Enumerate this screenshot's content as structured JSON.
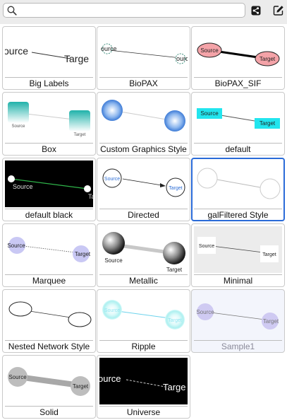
{
  "toolbar": {
    "search_value": "",
    "share_icon": "share-icon",
    "edit_icon": "edit-icon"
  },
  "styles": [
    {
      "label": "Big Labels",
      "source": "ource",
      "target": "Targe"
    },
    {
      "label": "BioPAX",
      "source": "ource",
      "target": "ource"
    },
    {
      "label": "BioPAX_SIF",
      "source": "Source",
      "target": "Target"
    },
    {
      "label": "Box",
      "source": "Source",
      "target": "Target"
    },
    {
      "label": "Custom Graphics Style",
      "source": "",
      "target": ""
    },
    {
      "label": "default",
      "source": "Source",
      "target": "Target"
    },
    {
      "label": "default black",
      "source": "Source",
      "target": "Ta"
    },
    {
      "label": "Directed",
      "source": "Source",
      "target": "Target"
    },
    {
      "label": "galFiltered Style",
      "source": "",
      "target": ""
    },
    {
      "label": "Marquee",
      "source": "Source",
      "target": "Target"
    },
    {
      "label": "Metallic",
      "source": "Source",
      "target": "Target"
    },
    {
      "label": "Minimal",
      "source": "Source",
      "target": "Target"
    },
    {
      "label": "Nested Network Style",
      "source": "",
      "target": ""
    },
    {
      "label": "Ripple",
      "source": "Source",
      "target": "Target"
    },
    {
      "label": "Sample1",
      "source": "Source",
      "target": "Target"
    },
    {
      "label": "Solid",
      "source": "Source",
      "target": "Target"
    },
    {
      "label": "Universe",
      "source": "ource",
      "target": "Targe"
    }
  ],
  "selected_style": "galFiltered Style",
  "colors": {
    "selection": "#2a6bd8",
    "biopax_sif_node": "#f4a3a8",
    "box_node": "#20b2aa",
    "custom_graphics_node": "#4a86d8",
    "default_node": "#22e5ee",
    "default_black_edge": "#2fb54a",
    "marquee_node": "#c9c8f4",
    "ripple_node": "#bff5f5",
    "ripple_edge": "#6ed3ec",
    "sample1_node": "#cfcaf2",
    "solid_node": "#bdbdbd"
  }
}
